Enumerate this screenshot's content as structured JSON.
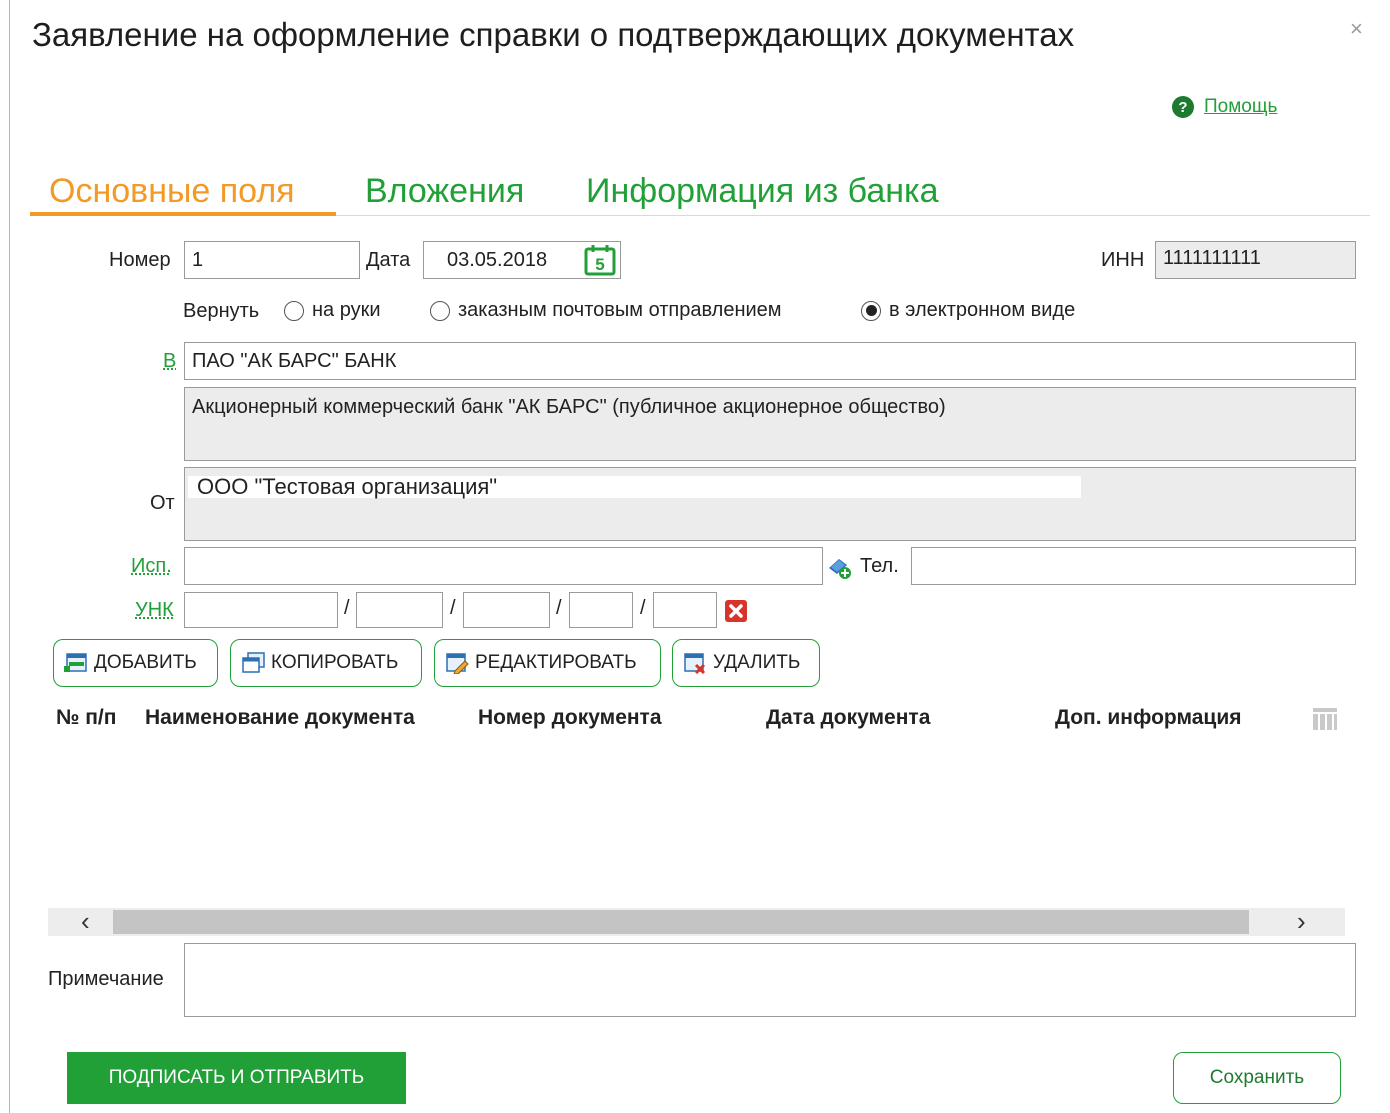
{
  "window": {
    "title": "Заявление на оформление справки о подтверждающих документах",
    "close_glyph": "×"
  },
  "help": {
    "icon_glyph": "?",
    "label": "Помощь"
  },
  "tabs": [
    {
      "label": "Основные поля",
      "active": true
    },
    {
      "label": "Вложения",
      "active": false
    },
    {
      "label": "Информация из банка",
      "active": false
    }
  ],
  "form": {
    "number_label": "Номер",
    "number_value": "1",
    "date_label": "Дата",
    "date_value": "03.05.2018",
    "calendar_day": "5",
    "inn_label": "ИНН",
    "inn_value": "1111111111",
    "return_label": "Вернуть",
    "return_options": [
      {
        "label": "на руки",
        "selected": false
      },
      {
        "label": "заказным почтовым отправлением",
        "selected": false
      },
      {
        "label": "в электронном виде",
        "selected": true
      }
    ],
    "bank_label": "В",
    "bank_short": "ПАО \"АК БАРС\" БАНК",
    "bank_full": "Акционерный коммерческий банк \"АК БАРС\" (публичное акционерное общество)",
    "from_label": "От",
    "from_value": "ООО \"Тестовая организация\"",
    "executor_label": "Исп.",
    "executor_value": "",
    "phone_label": "Тел.",
    "phone_value": "",
    "unk_label": "УНК",
    "unk_separator": "/",
    "unk_parts": [
      "",
      "",
      "",
      "",
      ""
    ],
    "note_label": "Примечание",
    "note_value": ""
  },
  "toolbar": {
    "add": "ДОБАВИТЬ",
    "copy": "КОПИРОВАТЬ",
    "edit": "РЕДАКТИРОВАТЬ",
    "delete": "УДАЛИТЬ"
  },
  "table": {
    "columns": [
      "№ п/п",
      "Наименование документа",
      "Номер документа",
      "Дата документа",
      "Доп. информация"
    ],
    "rows": []
  },
  "scrollbar": {
    "left_glyph": "‹",
    "right_glyph": "›"
  },
  "actions": {
    "sign_send": "ПОДПИСАТЬ И ОТПРАВИТЬ",
    "save": "Сохранить"
  },
  "colors": {
    "accent_green": "#21a038",
    "active_tab_orange": "#f39a26",
    "delete_red": "#d9342b"
  }
}
